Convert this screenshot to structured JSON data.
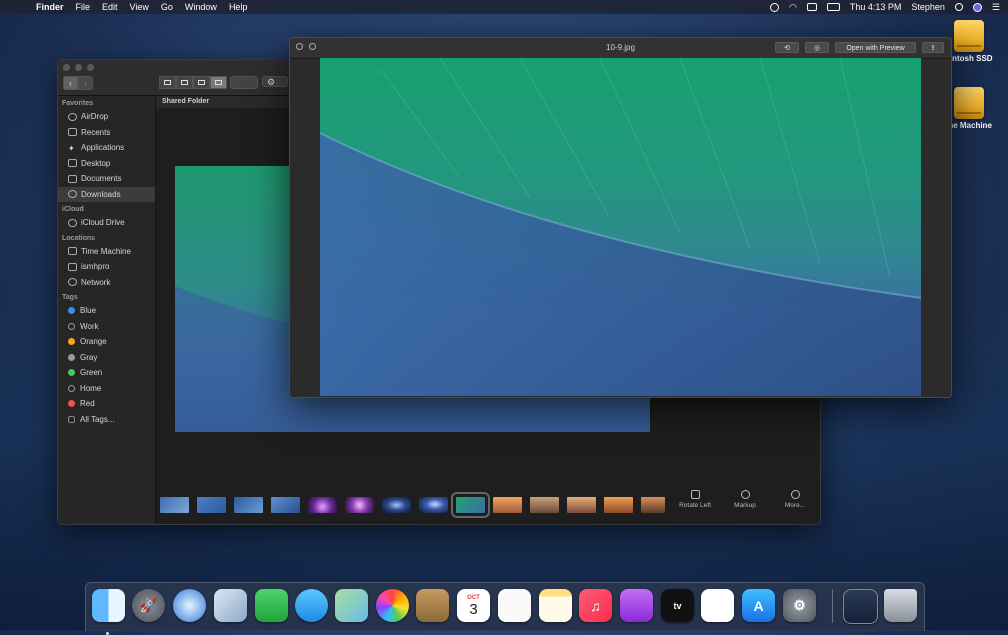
{
  "menubar": {
    "app": "Finder",
    "menus": [
      "File",
      "Edit",
      "View",
      "Go",
      "Window",
      "Help"
    ],
    "clock": "Thu 4:13 PM",
    "user": "Stephen"
  },
  "desktop": {
    "drives": [
      {
        "label": "Macintosh SSD",
        "visible_label": "cintosh SSD"
      },
      {
        "label": "Time Machine",
        "visible_label": "me Machine"
      }
    ]
  },
  "finder": {
    "path_title": "Shared Folder",
    "sidebar": {
      "favorites_header": "Favorites",
      "favorites": [
        "AirDrop",
        "Recents",
        "Applications",
        "Desktop",
        "Documents",
        "Downloads"
      ],
      "icloud_header": "iCloud",
      "icloud": [
        "iCloud Drive"
      ],
      "locations_header": "Locations",
      "locations": [
        "Time Machine",
        "ismhpro",
        "Network"
      ],
      "tags_header": "Tags",
      "tags": [
        {
          "label": "Blue",
          "color": "#3b8ff0"
        },
        {
          "label": "Work",
          "color": ""
        },
        {
          "label": "Orange",
          "color": "#f5a623"
        },
        {
          "label": "Gray",
          "color": "#9a9a9a"
        },
        {
          "label": "Green",
          "color": "#3ecf5a"
        },
        {
          "label": "Home",
          "color": ""
        },
        {
          "label": "Red",
          "color": "#ef5350"
        },
        {
          "label": "All Tags...",
          "color": ""
        }
      ]
    },
    "actions": [
      "Rotate Left",
      "Markup",
      "More..."
    ]
  },
  "quicklook": {
    "title": "10-9.jpg",
    "open_button": "Open with Preview"
  },
  "dock": {
    "apps": [
      "finder",
      "launchpad",
      "safari",
      "mail",
      "facetime",
      "messages",
      "maps",
      "photos",
      "contacts",
      "calendar",
      "reminders",
      "notes",
      "music",
      "podcasts",
      "tv",
      "news",
      "app-store",
      "system-preferences"
    ],
    "calendar_month": "OCT",
    "calendar_day": "3"
  }
}
